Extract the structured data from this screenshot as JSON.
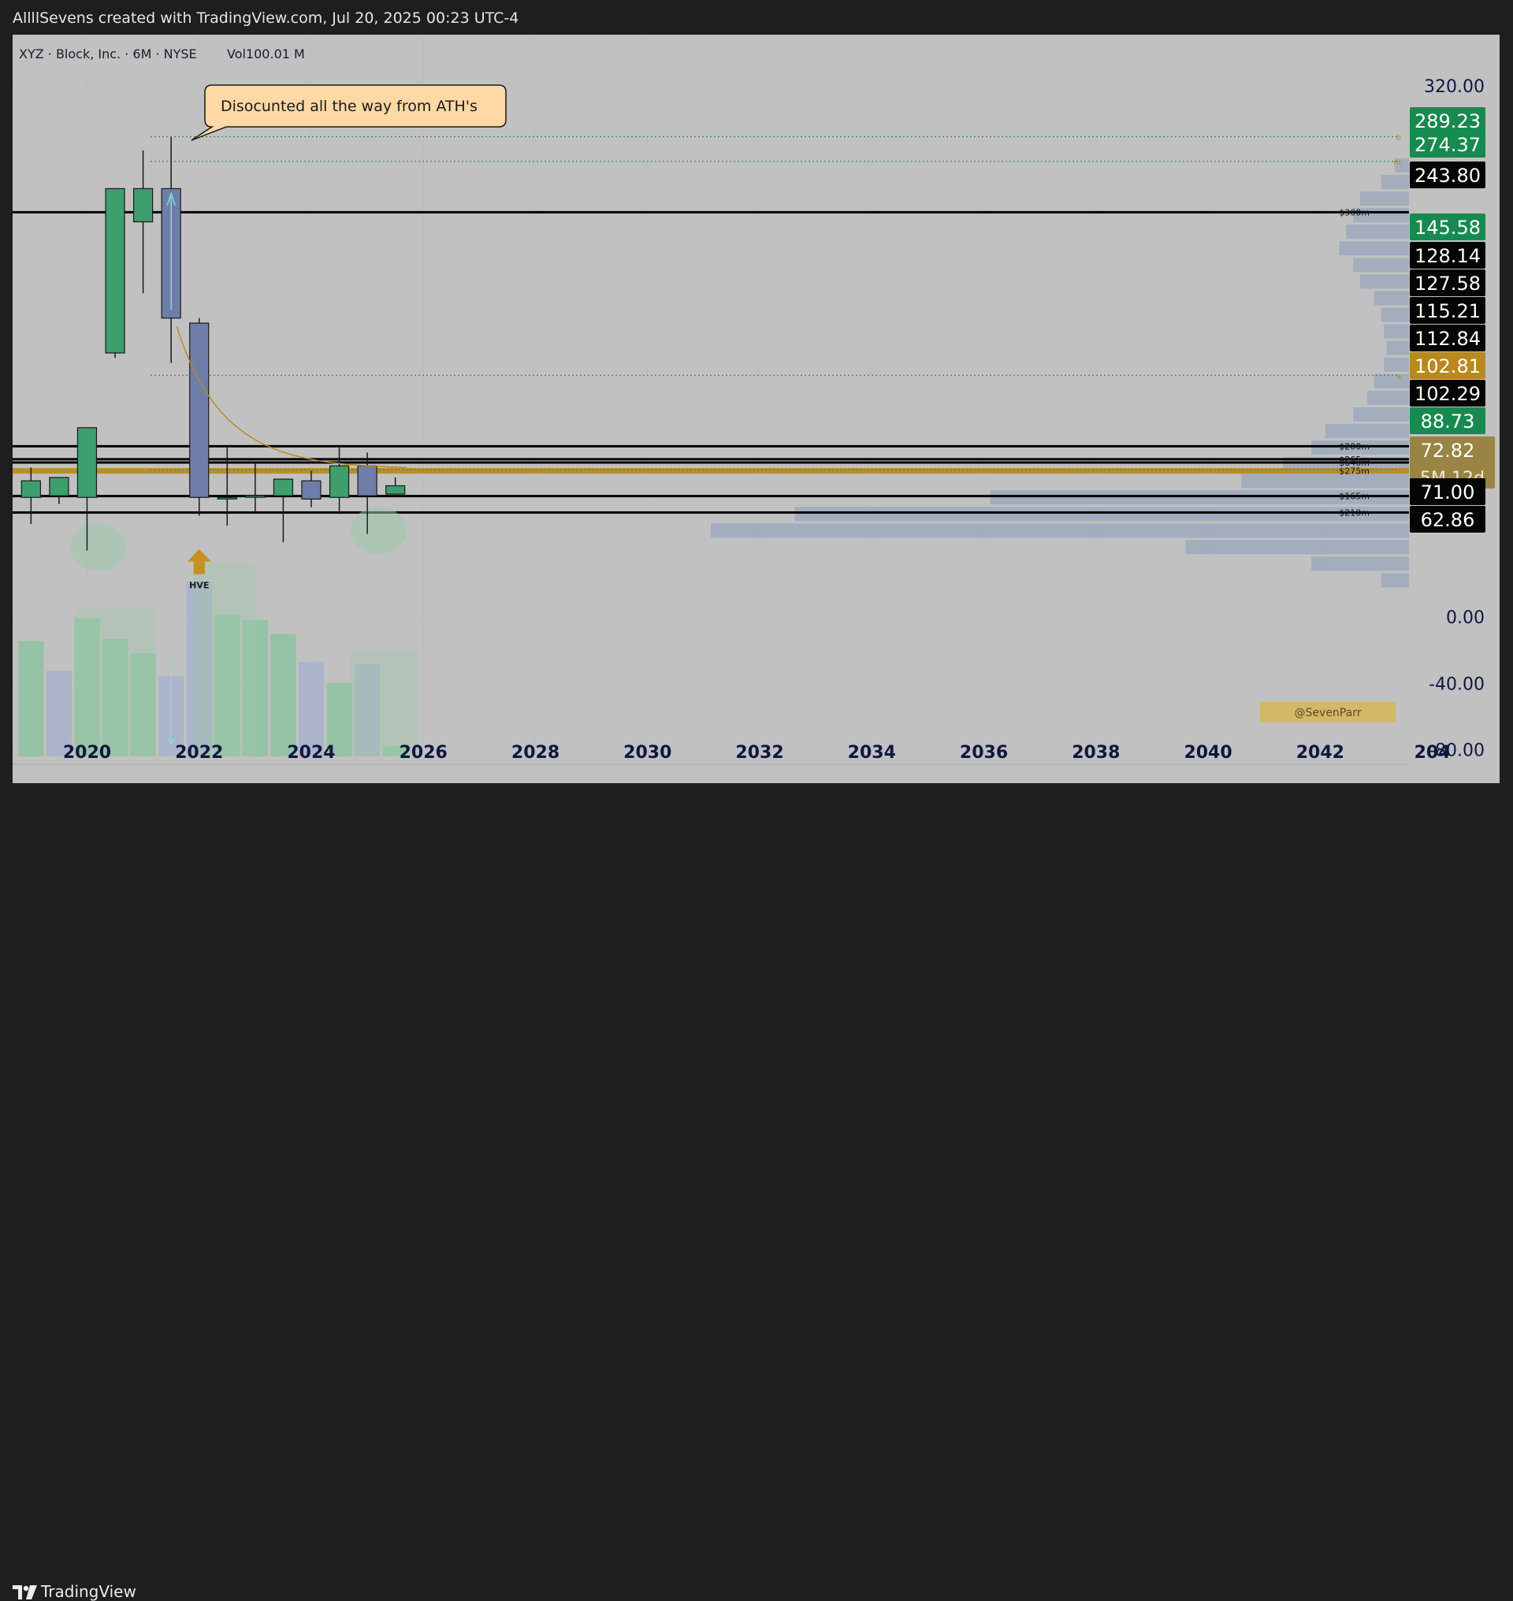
{
  "header": {
    "credit": "AllllSevens created with TradingView.com, Jul 20, 2025 00:23 UTC-4"
  },
  "symbol_line": {
    "ticker": "XYZ · Block, Inc. · 6M · NYSE",
    "volume": "Vol100.01 M"
  },
  "annotations": {
    "callout": "Disocunted all the way from ATH's",
    "hve": "HVE",
    "watermark": "@SevenParr"
  },
  "footer": {
    "brand": "TradingView"
  },
  "colors": {
    "background": "#c1c1c1",
    "bull": "#3f9e6d",
    "bear": "#6f7ea8",
    "gold": "#b8891d",
    "label_green": "#178a4f",
    "label_black": "#050505",
    "label_gold": "#b8891d",
    "volume_profile": "#9ea9bd"
  },
  "chart_data": {
    "type": "candlestick",
    "interval": "6M",
    "x_axis": {
      "range": [
        2018.7,
        2044.3
      ],
      "ticks": [
        "2020",
        "2022",
        "2024",
        "2026",
        "2028",
        "2030",
        "2032",
        "2034",
        "2036",
        "2038",
        "2040",
        "2042",
        "204"
      ]
    },
    "y_axis": {
      "range": [
        -80,
        340
      ],
      "ticks": [
        "320.00",
        "0.00",
        "-40.00",
        "-80.00"
      ]
    },
    "candles": [
      {
        "x": 2019.0,
        "open": 72,
        "high": 90,
        "low": 56,
        "close": 82
      },
      {
        "x": 2019.5,
        "open": 73,
        "high": 83,
        "low": 68,
        "close": 84
      },
      {
        "x": 2020.0,
        "open": 72,
        "high": 108,
        "low": 40,
        "close": 114
      },
      {
        "x": 2020.5,
        "open": 159,
        "high": 243,
        "low": 156,
        "close": 258
      },
      {
        "x": 2021.0,
        "open": 238,
        "high": 281,
        "low": 195,
        "close": 258
      },
      {
        "x": 2021.5,
        "open": 258,
        "high": 289,
        "low": 153,
        "close": 180
      },
      {
        "x": 2022.0,
        "open": 177,
        "high": 180,
        "low": 61,
        "close": 72
      },
      {
        "x": 2022.5,
        "open": 72,
        "high": 102,
        "low": 55,
        "close": 72
      },
      {
        "x": 2023.0,
        "open": 73,
        "high": 93,
        "low": 63,
        "close": 73
      },
      {
        "x": 2023.5,
        "open": 73,
        "high": 83,
        "low": 45,
        "close": 83
      },
      {
        "x": 2024.0,
        "open": 82,
        "high": 88,
        "low": 66,
        "close": 71
      },
      {
        "x": 2024.5,
        "open": 72,
        "high": 102,
        "low": 62,
        "close": 91
      },
      {
        "x": 2025.0,
        "open": 91,
        "high": 99,
        "low": 50,
        "close": 73
      },
      {
        "x": 2025.5,
        "open": 74,
        "high": 84,
        "low": 72,
        "close": 79
      }
    ],
    "volume": [
      {
        "x": 2019.0,
        "value": 0.66,
        "up": true
      },
      {
        "x": 2019.5,
        "value": 0.49,
        "up": false
      },
      {
        "x": 2020.0,
        "value": 0.79,
        "up": true
      },
      {
        "x": 2020.5,
        "value": 0.67,
        "up": true
      },
      {
        "x": 2021.0,
        "value": 0.59,
        "up": true
      },
      {
        "x": 2021.5,
        "value": 0.46,
        "up": false
      },
      {
        "x": 2022.0,
        "value": 1.0,
        "up": false
      },
      {
        "x": 2022.5,
        "value": 0.81,
        "up": true
      },
      {
        "x": 2023.0,
        "value": 0.78,
        "up": true
      },
      {
        "x": 2023.5,
        "value": 0.7,
        "up": true
      },
      {
        "x": 2024.0,
        "value": 0.54,
        "up": false
      },
      {
        "x": 2024.5,
        "value": 0.42,
        "up": true
      },
      {
        "x": 2025.0,
        "value": 0.53,
        "up": false
      },
      {
        "x": 2025.5,
        "value": 0.06,
        "up": true
      }
    ],
    "horizontal_lines": [
      {
        "price": 243.8,
        "style": "solid",
        "color": "#000000",
        "tag": "$300m"
      },
      {
        "price": 102.81,
        "style": "solid",
        "color": "#000000",
        "tag": "$200m"
      },
      {
        "price": 95,
        "style": "solid",
        "color": "#000000",
        "tag": "$265m"
      },
      {
        "price": 93,
        "style": "solid",
        "color": "#000000",
        "tag": "$640m"
      },
      {
        "price": 88,
        "style": "gold",
        "color": "#b8891d",
        "tag": "$275m"
      },
      {
        "price": 72.82,
        "style": "solid",
        "color": "#000000",
        "tag": "$165m"
      },
      {
        "price": 62.86,
        "style": "solid",
        "color": "#000000",
        "tag": "$210m"
      },
      {
        "price": 289.23,
        "style": "dotted",
        "color": "#2e8b57",
        "tag": "b"
      },
      {
        "price": 274.37,
        "style": "dotted",
        "color": "#2e8b57",
        "tag": "m"
      },
      {
        "price": 145.58,
        "style": "dotted",
        "color": "#2e8b57",
        "tag": "a"
      },
      {
        "price": 88.73,
        "style": "dotted",
        "color": "#2e8b57",
        "tag": "d"
      }
    ],
    "volume_profile": [
      {
        "price": 272,
        "width": 0.01
      },
      {
        "price": 262,
        "width": 0.02
      },
      {
        "price": 252,
        "width": 0.035
      },
      {
        "price": 242,
        "width": 0.04
      },
      {
        "price": 232,
        "width": 0.045
      },
      {
        "price": 222,
        "width": 0.05
      },
      {
        "price": 212,
        "width": 0.04
      },
      {
        "price": 202,
        "width": 0.035
      },
      {
        "price": 192,
        "width": 0.025
      },
      {
        "price": 182,
        "width": 0.02
      },
      {
        "price": 172,
        "width": 0.018
      },
      {
        "price": 162,
        "width": 0.016
      },
      {
        "price": 152,
        "width": 0.018
      },
      {
        "price": 142,
        "width": 0.025
      },
      {
        "price": 132,
        "width": 0.03
      },
      {
        "price": 122,
        "width": 0.04
      },
      {
        "price": 112,
        "width": 0.06
      },
      {
        "price": 102,
        "width": 0.07
      },
      {
        "price": 92,
        "width": 0.09
      },
      {
        "price": 82,
        "width": 0.12
      },
      {
        "price": 72,
        "width": 0.3
      },
      {
        "price": 62,
        "width": 0.44
      },
      {
        "price": 52,
        "width": 0.5
      },
      {
        "price": 42,
        "width": 0.16
      },
      {
        "price": 32,
        "width": 0.07
      },
      {
        "price": 22,
        "width": 0.02
      }
    ],
    "price_labels": [
      {
        "text": "289.23",
        "price": 289.23,
        "kind": "green"
      },
      {
        "text": "274.37",
        "price": 274.37,
        "kind": "green"
      },
      {
        "text": "243.80",
        "price": 243.8,
        "kind": "black"
      },
      {
        "text": "145.58",
        "price": 145.58,
        "kind": "green"
      },
      {
        "text": "128.14",
        "price": 128.14,
        "kind": "black"
      },
      {
        "text": "127.58",
        "price": 127.58,
        "kind": "black"
      },
      {
        "text": "115.21",
        "price": 115.21,
        "kind": "black"
      },
      {
        "text": "112.84",
        "price": 112.84,
        "kind": "black"
      },
      {
        "text": "102.81",
        "price": 102.81,
        "kind": "gold"
      },
      {
        "text": "102.29",
        "price": 102.29,
        "kind": "black"
      },
      {
        "text": "88.73",
        "price": 88.73,
        "kind": "green"
      },
      {
        "text": "72.82",
        "price": 72.82,
        "kind": "goldbig",
        "sub": "5M 12d"
      },
      {
        "text": "71.00",
        "price": 71.0,
        "kind": "black"
      },
      {
        "text": "62.86",
        "price": 62.86,
        "kind": "black"
      }
    ]
  }
}
